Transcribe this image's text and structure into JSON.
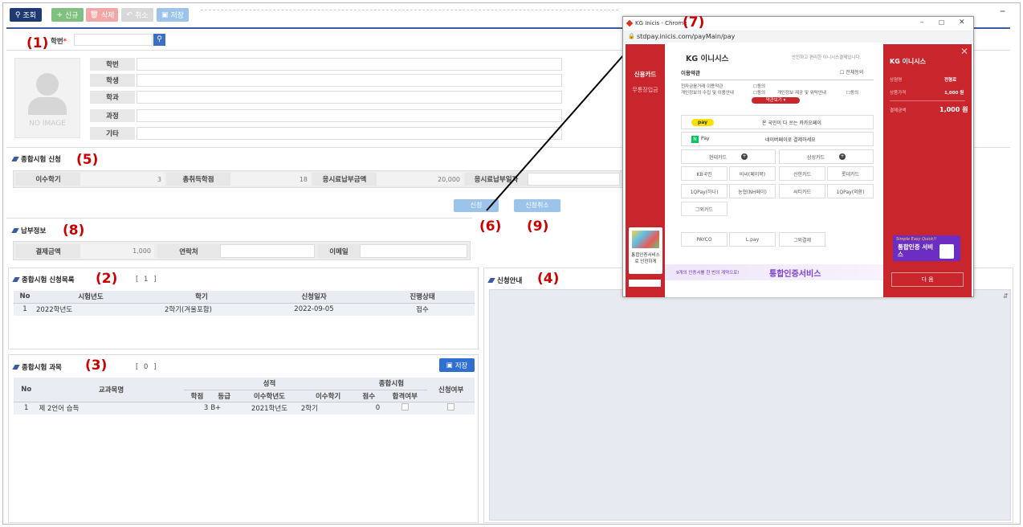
{
  "toolbar": {
    "search": "조회",
    "new": "신규",
    "delete": "삭제",
    "cancel": "취소",
    "save": "저장"
  },
  "annotations": {
    "a1": "(1)",
    "a2": "(2)",
    "a3": "(3)",
    "a4": "(4)",
    "a5": "(5)",
    "a6": "(6)",
    "a7": "(7)",
    "a8": "(8)",
    "a9": "(9)"
  },
  "student": {
    "id_label": "학번",
    "id_value": "",
    "image_text": "NO IMAGE",
    "fields": [
      {
        "label": "학번"
      },
      {
        "label": "학생"
      },
      {
        "label": "학과"
      },
      {
        "label": "과정"
      },
      {
        "label": "기타"
      }
    ]
  },
  "exam_apply": {
    "title": "종합시험 신청",
    "semesters_label": "이수학기",
    "semesters": "3",
    "credits_label": "총취득학점",
    "credits": "18",
    "fee_label": "응시료납부금액",
    "fee": "20,000",
    "paydate_label": "응시료납부일자",
    "apply_btn": "신청",
    "cancel_btn": "신청취소"
  },
  "payment": {
    "title": "납부정보",
    "amount_label": "결제금액",
    "amount": "1,000",
    "contact_label": "연락처",
    "email_label": "이메일"
  },
  "apply_list": {
    "title": "종합시험 신청목록",
    "count": "[ 1 ]",
    "headers": {
      "no": "No",
      "year": "시험년도",
      "term": "학기",
      "date": "신청일자",
      "status": "진행상태"
    },
    "rows": [
      {
        "no": "1",
        "year": "2022학년도",
        "term": "2학기(겨울포함)",
        "date": "2022-09-05",
        "status": "접수"
      }
    ]
  },
  "subjects": {
    "title": "종합시험 과목",
    "count": "[ 0 ]",
    "save": "저장",
    "headers": {
      "no": "No",
      "subject": "교과목명",
      "grade": "성적",
      "exam": "종합시험",
      "apply": "신청여부",
      "credit": "학점",
      "level": "등급",
      "year": "이수학년도",
      "term": "이수학기",
      "score": "점수",
      "pass": "합격여부"
    },
    "rows": [
      {
        "no": "1",
        "subject": "제 2언어 습득",
        "credit": "3",
        "level": "B+",
        "year": "2021학년도",
        "term": "2학기",
        "score": "0"
      }
    ]
  },
  "guide": {
    "title": "신청안내"
  },
  "popup": {
    "window_title": "KG Inicis - Chrome",
    "url": "stdpay.inicis.com/payMain/pay",
    "left_menu": [
      "신용카드",
      "무통장입금"
    ],
    "brand": "KG 이니시스",
    "tagline": "안전하고 편리한 이니시스결제입니다.",
    "terms_title": "이용약관",
    "agree_all": "전체동의",
    "term1": "전자금융거래 이용약관",
    "term2": "개인정보의 수집 및 이용안내",
    "term3": "개인정보 제공 및 위탁안내",
    "agree": "동의",
    "terms_more": "약관보기",
    "kakao": "pay",
    "kakao_text": "온 국민이 다 쓰는 카카오페이",
    "naver": "Pay",
    "naver_text": "네이버페이로 결제하세요",
    "hyundai": "현대카드",
    "samsung": "삼성카드",
    "cards": [
      "KB국민",
      "비씨(페이북)",
      "신한카드",
      "롯데카드",
      "1QPay(하나)",
      "농협(NH페이)",
      "씨티카드",
      "1QPay(외환)",
      "그외카드"
    ],
    "others": [
      "PAYCO",
      "L.pay",
      "그외결제"
    ],
    "promo_left": "통합인증서비스로 안전하게",
    "banner_text": "9개의 인증서를 한 번의 계약으로!",
    "banner_big": "통합인증서비스",
    "right_brand": "KG 이니시스",
    "info_rows": [
      {
        "k": "상점명",
        "v": "전형료"
      },
      {
        "k": "상품가격",
        "v": "1,000 원"
      }
    ],
    "total_label": "결제금액",
    "total": "1,000 원",
    "promo_right_small": "Simple Easy Quick!!",
    "promo_right": "통합인증 서비스",
    "next_btn": "다 음",
    "win_controls": [
      "–",
      "☐",
      "✕"
    ]
  }
}
